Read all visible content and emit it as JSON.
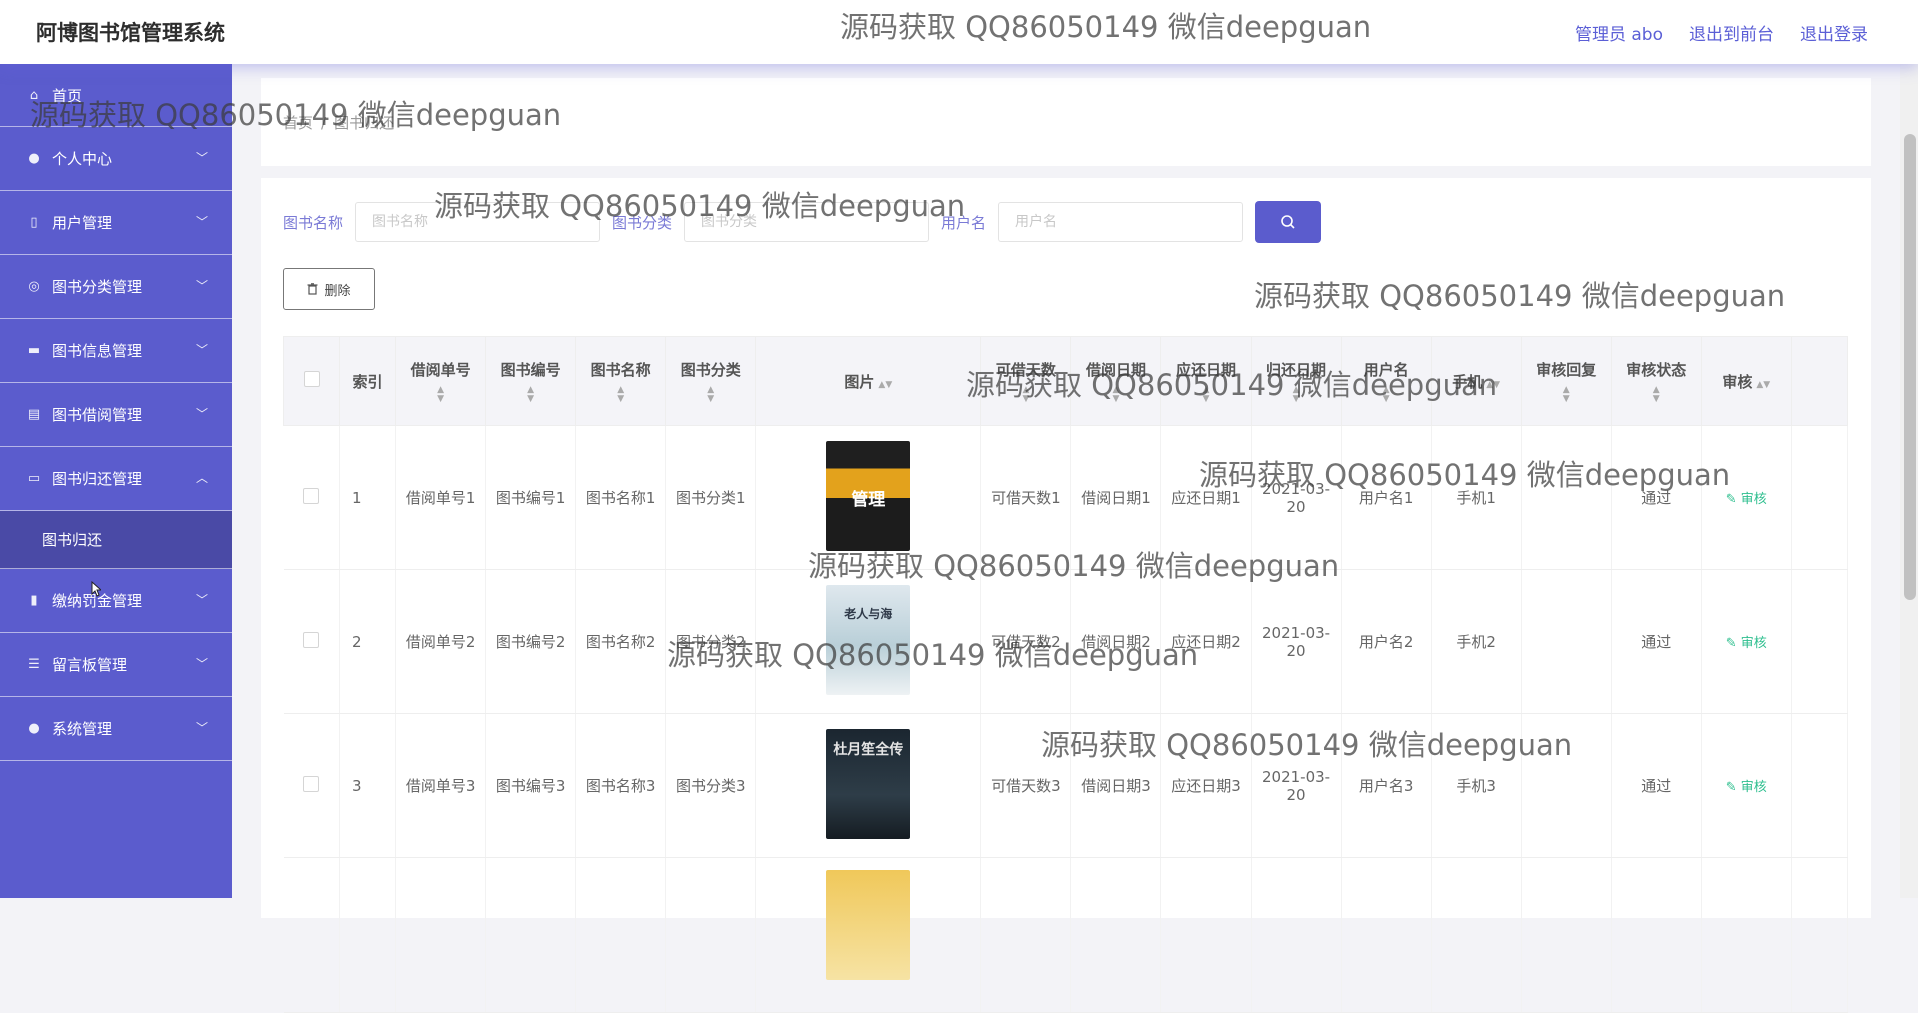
{
  "header": {
    "app_title": "阿博图书馆管理系统",
    "links": [
      "管理员 abo",
      "退出到前台",
      "退出登录"
    ]
  },
  "watermark": "源码获取 QQ86050149 微信deepguan",
  "sidebar": {
    "items": [
      {
        "label": "首页",
        "icon": "home-icon"
      },
      {
        "label": "个人中心",
        "icon": "user-icon"
      },
      {
        "label": "用户管理",
        "icon": "phone-icon"
      },
      {
        "label": "图书分类管理",
        "icon": "circle-icon"
      },
      {
        "label": "图书信息管理",
        "icon": "briefcase-icon"
      },
      {
        "label": "图书借阅管理",
        "icon": "clipboard-icon"
      },
      {
        "label": "图书归还管理",
        "icon": "monitor-icon"
      },
      {
        "label": "缴纳罚金管理",
        "icon": "bar-chart-icon"
      },
      {
        "label": "留言板管理",
        "icon": "list-icon"
      },
      {
        "label": "系统管理",
        "icon": "palette-icon"
      }
    ],
    "active_sub": "图书归还"
  },
  "breadcrumb": {
    "home": "首页",
    "current": "图书归还",
    "sep": "/"
  },
  "search": {
    "fields": [
      {
        "label": "图书名称",
        "placeholder": "图书名称"
      },
      {
        "label": "图书分类",
        "placeholder": "图书分类"
      },
      {
        "label": "用户名",
        "placeholder": "用户名"
      }
    ]
  },
  "delete_label": "删除",
  "table": {
    "headers": [
      "索引",
      "借阅单号",
      "图书编号",
      "图书名称",
      "图书分类",
      "图片",
      "可借天数",
      "借阅日期",
      "应还日期",
      "归还日期",
      "用户名",
      "手机",
      "审核回复",
      "审核状态",
      "审核"
    ],
    "rows": [
      {
        "idx": "1",
        "c1": "借阅单号1",
        "c2": "图书编号1",
        "c3": "图书名称1",
        "c4": "图书分类1",
        "cover": "管理",
        "c6": "可借天数1",
        "c7": "借阅日期1",
        "c8": "应还日期1",
        "c9": "2021-03-20",
        "c10": "用户名1",
        "c11": "手机1",
        "c12": "",
        "c13": "通过",
        "c14": "审核"
      },
      {
        "idx": "2",
        "c1": "借阅单号2",
        "c2": "图书编号2",
        "c3": "图书名称2",
        "c4": "图书分类2",
        "cover": "老人与海",
        "c6": "可借天数2",
        "c7": "借阅日期2",
        "c8": "应还日期2",
        "c9": "2021-03-20",
        "c10": "用户名2",
        "c11": "手机2",
        "c12": "",
        "c13": "通过",
        "c14": "审核"
      },
      {
        "idx": "3",
        "c1": "借阅单号3",
        "c2": "图书编号3",
        "c3": "图书名称3",
        "c4": "图书分类3",
        "cover": "杜月笙全传",
        "c6": "可借天数3",
        "c7": "借阅日期3",
        "c8": "应还日期3",
        "c9": "2021-03-20",
        "c10": "用户名3",
        "c11": "手机3",
        "c12": "",
        "c13": "通过",
        "c14": "审核"
      }
    ]
  }
}
